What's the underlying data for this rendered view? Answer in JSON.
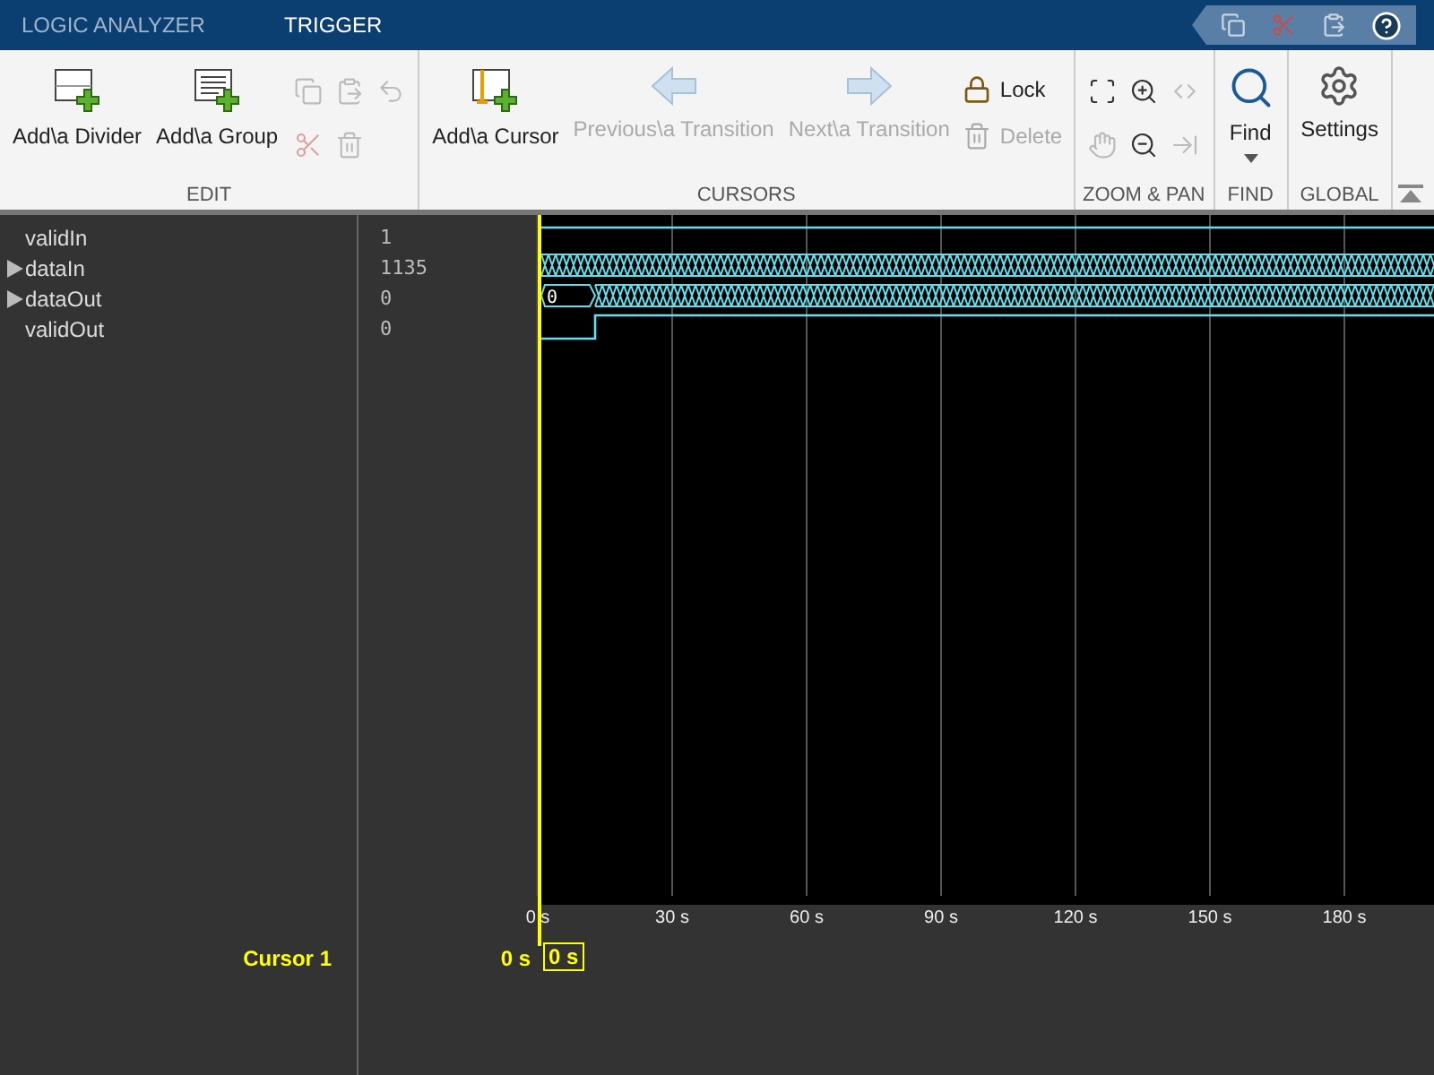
{
  "tabs": [
    {
      "label": "LOGIC ANALYZER",
      "selected": false
    },
    {
      "label": "TRIGGER",
      "selected": true
    }
  ],
  "toolstrip": {
    "sections": [
      {
        "title": "EDIT",
        "large": [
          {
            "kind": "divider",
            "label": "Add\\a Divider",
            "disabled": false
          },
          {
            "kind": "group",
            "label": "Add\\a Group",
            "disabled": false
          }
        ],
        "small": [
          {
            "kind": "copy",
            "disabled": true
          },
          {
            "kind": "paste",
            "disabled": true
          },
          {
            "kind": "undo",
            "disabled": true
          },
          {
            "kind": "cut",
            "disabled": true
          },
          {
            "kind": "trash",
            "disabled": true
          }
        ]
      },
      {
        "title": "CURSORS",
        "large": [
          {
            "kind": "cursor",
            "label": "Add\\a Cursor",
            "disabled": false
          },
          {
            "kind": "prev",
            "label": "Previous\\a Transition",
            "disabled": true
          },
          {
            "kind": "next",
            "label": "Next\\a Transition",
            "disabled": true
          }
        ],
        "rows": [
          {
            "kind": "lock",
            "label": "Lock",
            "disabled": false
          },
          {
            "kind": "trash",
            "label": "Delete",
            "disabled": true
          }
        ]
      },
      {
        "title": "ZOOM & PAN",
        "small": [
          {
            "kind": "zoomfit",
            "disabled": false
          },
          {
            "kind": "zoomin",
            "disabled": false
          },
          {
            "kind": "fitx",
            "disabled": true
          },
          {
            "kind": "hand",
            "disabled": true
          },
          {
            "kind": "zoomout",
            "disabled": false
          },
          {
            "kind": "jump",
            "disabled": true
          }
        ]
      },
      {
        "title": "FIND",
        "large": [
          {
            "kind": "find",
            "label": "Find",
            "disabled": false
          }
        ]
      },
      {
        "title": "GLOBAL",
        "large": [
          {
            "kind": "settings",
            "label": "Settings",
            "disabled": false
          }
        ]
      }
    ]
  },
  "signals": [
    {
      "name": "validIn",
      "value": "1",
      "expandable": false,
      "kind": "bit"
    },
    {
      "name": "dataIn",
      "value": "1135",
      "expandable": true,
      "kind": "bus"
    },
    {
      "name": "dataOut",
      "value": "0",
      "expandable": true,
      "kind": "bus",
      "first_value": "0"
    },
    {
      "name": "validOut",
      "value": "0",
      "expandable": false,
      "kind": "step"
    }
  ],
  "axis": {
    "ticks": [
      "0 s",
      "30 s",
      "60 s",
      "90 s",
      "120 s",
      "150 s",
      "180 s"
    ]
  },
  "cursor": {
    "name": "Cursor 1",
    "value": "0 s",
    "marker": "0 s"
  }
}
